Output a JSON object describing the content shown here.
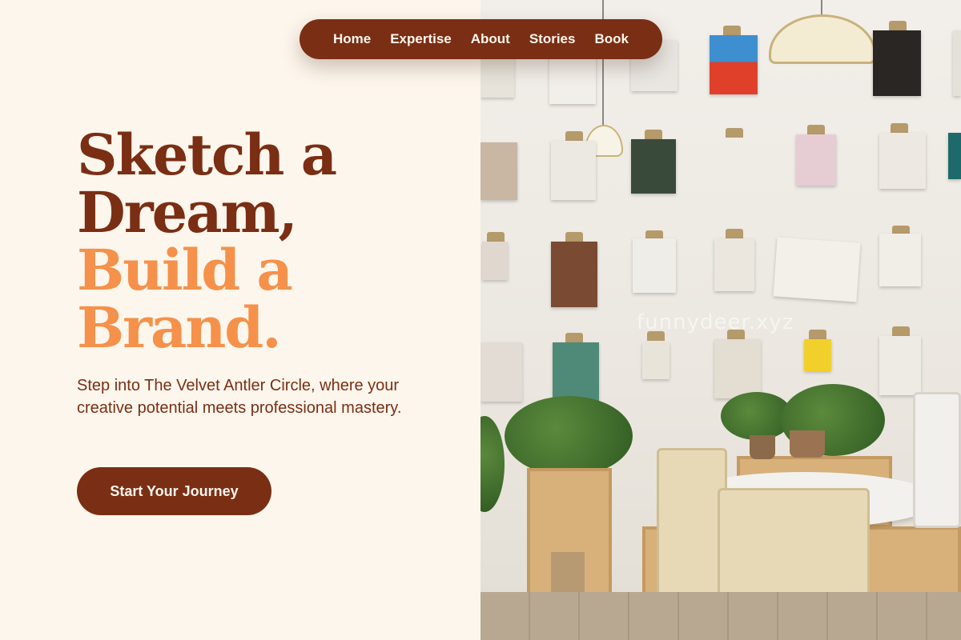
{
  "nav": {
    "items": [
      "Home",
      "Expertise",
      "About",
      "Stories",
      "Book"
    ]
  },
  "hero": {
    "headline_line1": "Sketch a",
    "headline_line2": "Dream,",
    "headline_line3": "Build a",
    "headline_line4": "Brand.",
    "subtext": "Step into The Velvet Antler Circle, where your creative potential meets professional mastery.",
    "cta_label": "Start Your Journey"
  },
  "photo": {
    "watermark": "funnydeer.xyz"
  },
  "colors": {
    "brand_dark": "#7a2e14",
    "brand_accent": "#f5914a",
    "background": "#fdf6ec"
  }
}
